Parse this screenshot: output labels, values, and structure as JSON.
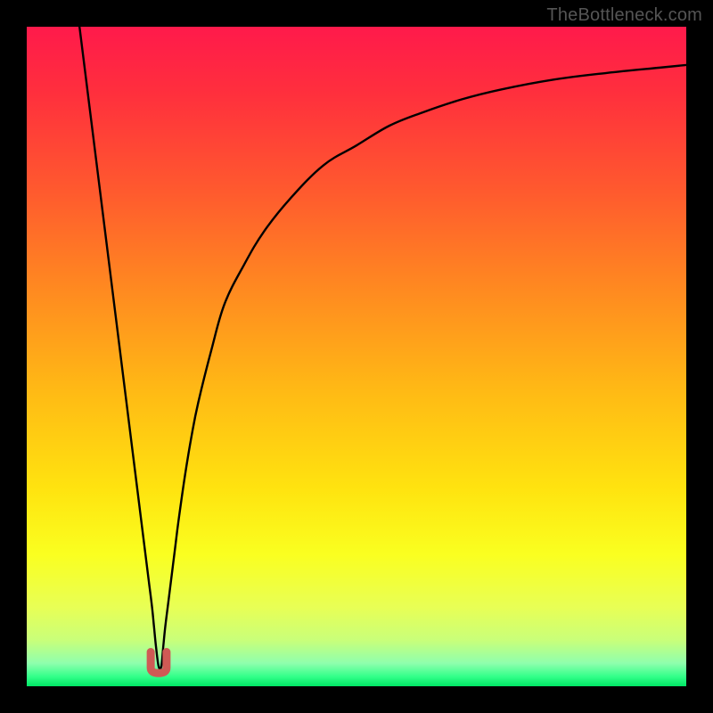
{
  "watermark": "TheBottleneck.com",
  "colors": {
    "frame": "#000000",
    "gradient_stops": [
      {
        "offset": 0.0,
        "color": "#ff1a4b"
      },
      {
        "offset": 0.1,
        "color": "#ff2f3d"
      },
      {
        "offset": 0.25,
        "color": "#ff5a2e"
      },
      {
        "offset": 0.4,
        "color": "#ff8a20"
      },
      {
        "offset": 0.55,
        "color": "#ffb915"
      },
      {
        "offset": 0.7,
        "color": "#ffe30f"
      },
      {
        "offset": 0.8,
        "color": "#faff20"
      },
      {
        "offset": 0.88,
        "color": "#e8ff55"
      },
      {
        "offset": 0.93,
        "color": "#c9ff7a"
      },
      {
        "offset": 0.965,
        "color": "#8fffad"
      },
      {
        "offset": 0.985,
        "color": "#34ff8a"
      },
      {
        "offset": 1.0,
        "color": "#00e765"
      }
    ],
    "curve": "#000000",
    "marker_fill": "#cf5a55",
    "marker_stroke": "#b94a45"
  },
  "chart_data": {
    "type": "line",
    "title": "",
    "xlabel": "",
    "ylabel": "",
    "xlim": [
      0,
      100
    ],
    "ylim": [
      0,
      100
    ],
    "series": [
      {
        "name": "bottleneck-curve",
        "x": [
          8,
          9,
          10,
          11,
          12,
          13,
          14,
          15,
          16,
          17,
          17.5,
          18,
          18.5,
          19,
          19.3,
          19.6,
          20,
          20.4,
          20.7,
          21,
          21.5,
          22,
          22.5,
          23,
          24,
          25,
          26,
          28,
          30,
          33,
          36,
          40,
          45,
          50,
          55,
          60,
          66,
          72,
          80,
          88,
          96,
          100
        ],
        "y": [
          100,
          92,
          84,
          76,
          68,
          60,
          52,
          44,
          36,
          28,
          24,
          20,
          16,
          12,
          9,
          6,
          3,
          3,
          6,
          9,
          13,
          17,
          21,
          25,
          32,
          38,
          43,
          51,
          58,
          64,
          69,
          74,
          79,
          82,
          85,
          87,
          89,
          90.5,
          92,
          93,
          93.8,
          94.2
        ]
      }
    ],
    "annotations": [
      {
        "name": "optimal-marker",
        "shape": "u",
        "x": 20,
        "y": 2,
        "width": 2.4,
        "height": 3.2
      }
    ],
    "legend": false,
    "grid": false
  }
}
